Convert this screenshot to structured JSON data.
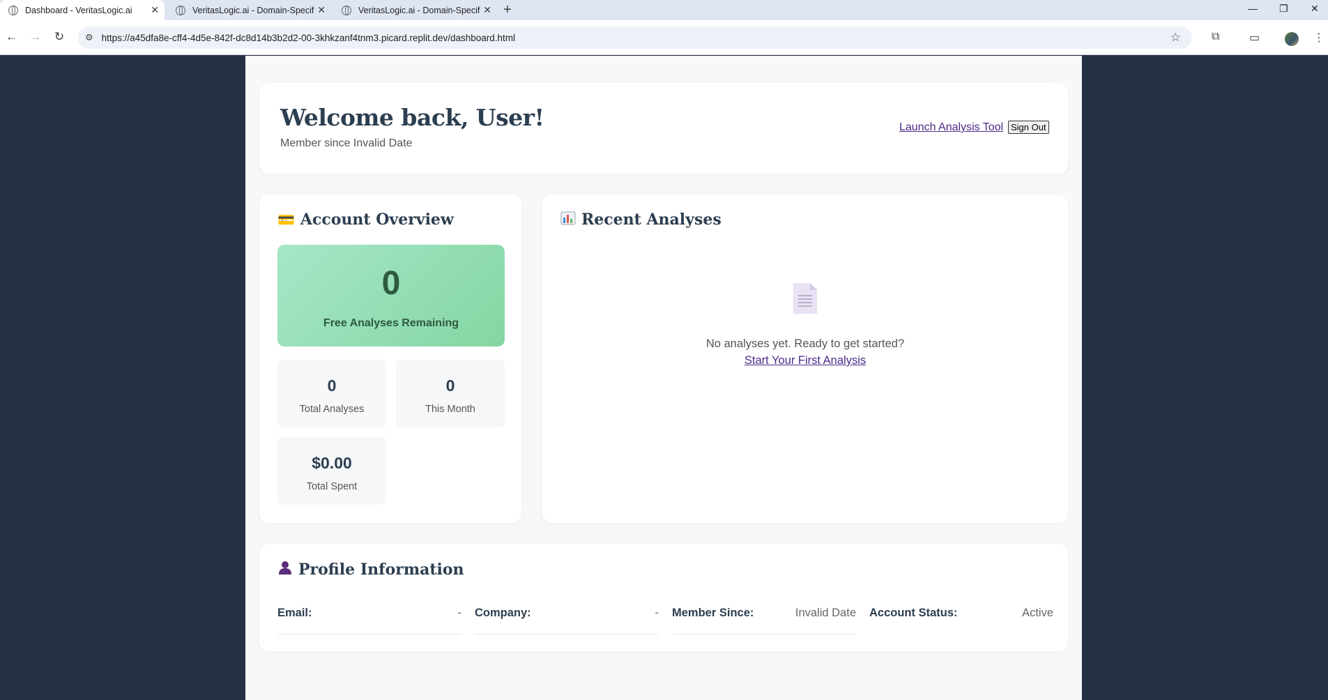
{
  "browser": {
    "tabs": [
      {
        "title": "Dashboard - VeritasLogic.ai",
        "active": true
      },
      {
        "title": "VeritasLogic.ai - Domain-Specifi",
        "active": false
      },
      {
        "title": "VeritasLogic.ai - Domain-Specifi",
        "active": false
      }
    ],
    "url": "https://a45dfa8e-cff4-4d5e-842f-dc8d14b3b2d2-00-3khkzanf4tnm3.picard.replit.dev/dashboard.html"
  },
  "header": {
    "welcome": "Welcome back, User!",
    "member_since": "Member since Invalid Date",
    "launch_link": "Launch Analysis Tool",
    "sign_out": "Sign Out"
  },
  "account": {
    "title": "Account Overview",
    "icon": "credit-card-icon",
    "free_count": "0",
    "free_label": "Free Analyses Remaining",
    "stats": [
      {
        "value": "0",
        "label": "Total Analyses"
      },
      {
        "value": "0",
        "label": "This Month"
      },
      {
        "value": "$0.00",
        "label": "Total Spent"
      }
    ]
  },
  "recent": {
    "title": "Recent Analyses",
    "icon": "bar-chart-icon",
    "empty_text": "No analyses yet. Ready to get started?",
    "start_link": "Start Your First Analysis"
  },
  "profile": {
    "title": "Profile Information",
    "icon": "user-icon",
    "fields": [
      {
        "label": "Email:",
        "value": "-"
      },
      {
        "label": "Company:",
        "value": "-"
      },
      {
        "label": "Member Since:",
        "value": "Invalid Date"
      },
      {
        "label": "Account Status:",
        "value": "Active"
      }
    ]
  },
  "colors": {
    "sidebar_bg": "#243142",
    "accent_green": "#84d6a2",
    "link": "#4b2a8a"
  }
}
